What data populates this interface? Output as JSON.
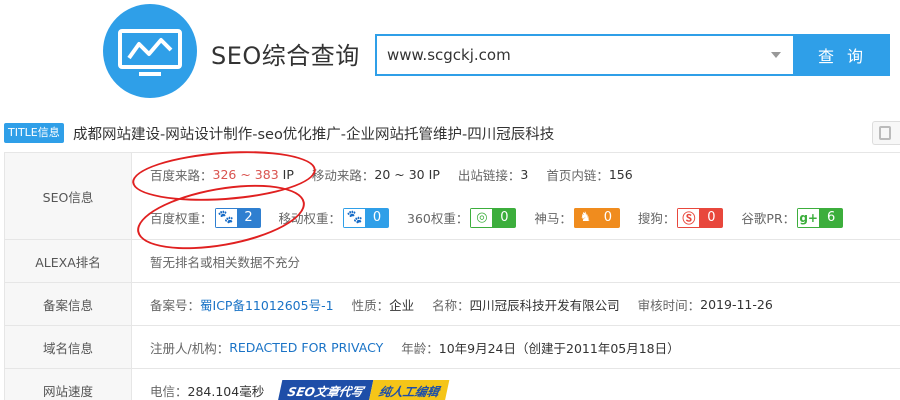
{
  "header": {
    "brand": "SEO综合查询",
    "search_value": "www.scgckj.com",
    "search_button": "查 询"
  },
  "title_row": {
    "tag": "TITLE信息",
    "text": "成都网站建设-网站设计制作-seo优化推广-企业网站托管维护-四川冠辰科技"
  },
  "seo_info": {
    "label": "SEO信息",
    "baidu_traffic_label": "百度来路：",
    "baidu_traffic_value": "326 ~ 383",
    "baidu_traffic_unit": "IP",
    "mobile_traffic_label": "移动来路：",
    "mobile_traffic_value": "20 ~ 30",
    "mobile_traffic_unit": "IP",
    "outbound_label": "出站链接：",
    "outbound_value": "3",
    "inner_label": "首页内链：",
    "inner_value": "156",
    "weights": [
      {
        "label": "百度权重：",
        "value": "2",
        "color": "#2f7fd0",
        "icon": "paw-icon"
      },
      {
        "label": "移动权重：",
        "value": "0",
        "color": "#2f9fe8",
        "icon": "paw-icon"
      },
      {
        "label": "360权重：",
        "value": "0",
        "color": "#3cae3c",
        "icon": "360-icon"
      },
      {
        "label": "神马：",
        "value": "0",
        "color": "#f08c1e",
        "icon": "shenma-icon"
      },
      {
        "label": "搜狗：",
        "value": "0",
        "color": "#e8473c",
        "icon": "sogou-icon"
      },
      {
        "label": "谷歌PR：",
        "value": "6",
        "color": "#3cae3c",
        "icon": "google-plus-icon"
      }
    ]
  },
  "alexa": {
    "label": "ALEXA排名",
    "value": "暂无排名或相关数据不充分"
  },
  "icp": {
    "label": "备案信息",
    "num_label": "备案号：",
    "num_value": "蜀ICP备11012605号-1",
    "nature_label": "性质：",
    "nature_value": "企业",
    "name_label": "名称：",
    "name_value": "四川冠辰科技开发有限公司",
    "date_label": "审核时间：",
    "date_value": "2019-11-26"
  },
  "domain": {
    "label": "域名信息",
    "reg_label": "注册人/机构：",
    "reg_value": "REDACTED FOR PRIVACY",
    "age_label": "年龄：",
    "age_value": "10年9月24日（创建于2011年05月18日）"
  },
  "speed": {
    "label": "网站速度",
    "telecom_label": "电信：",
    "telecom_value": "284.104毫秒",
    "promo1": "SEO文章代写",
    "promo2": "纯人工编辑"
  }
}
